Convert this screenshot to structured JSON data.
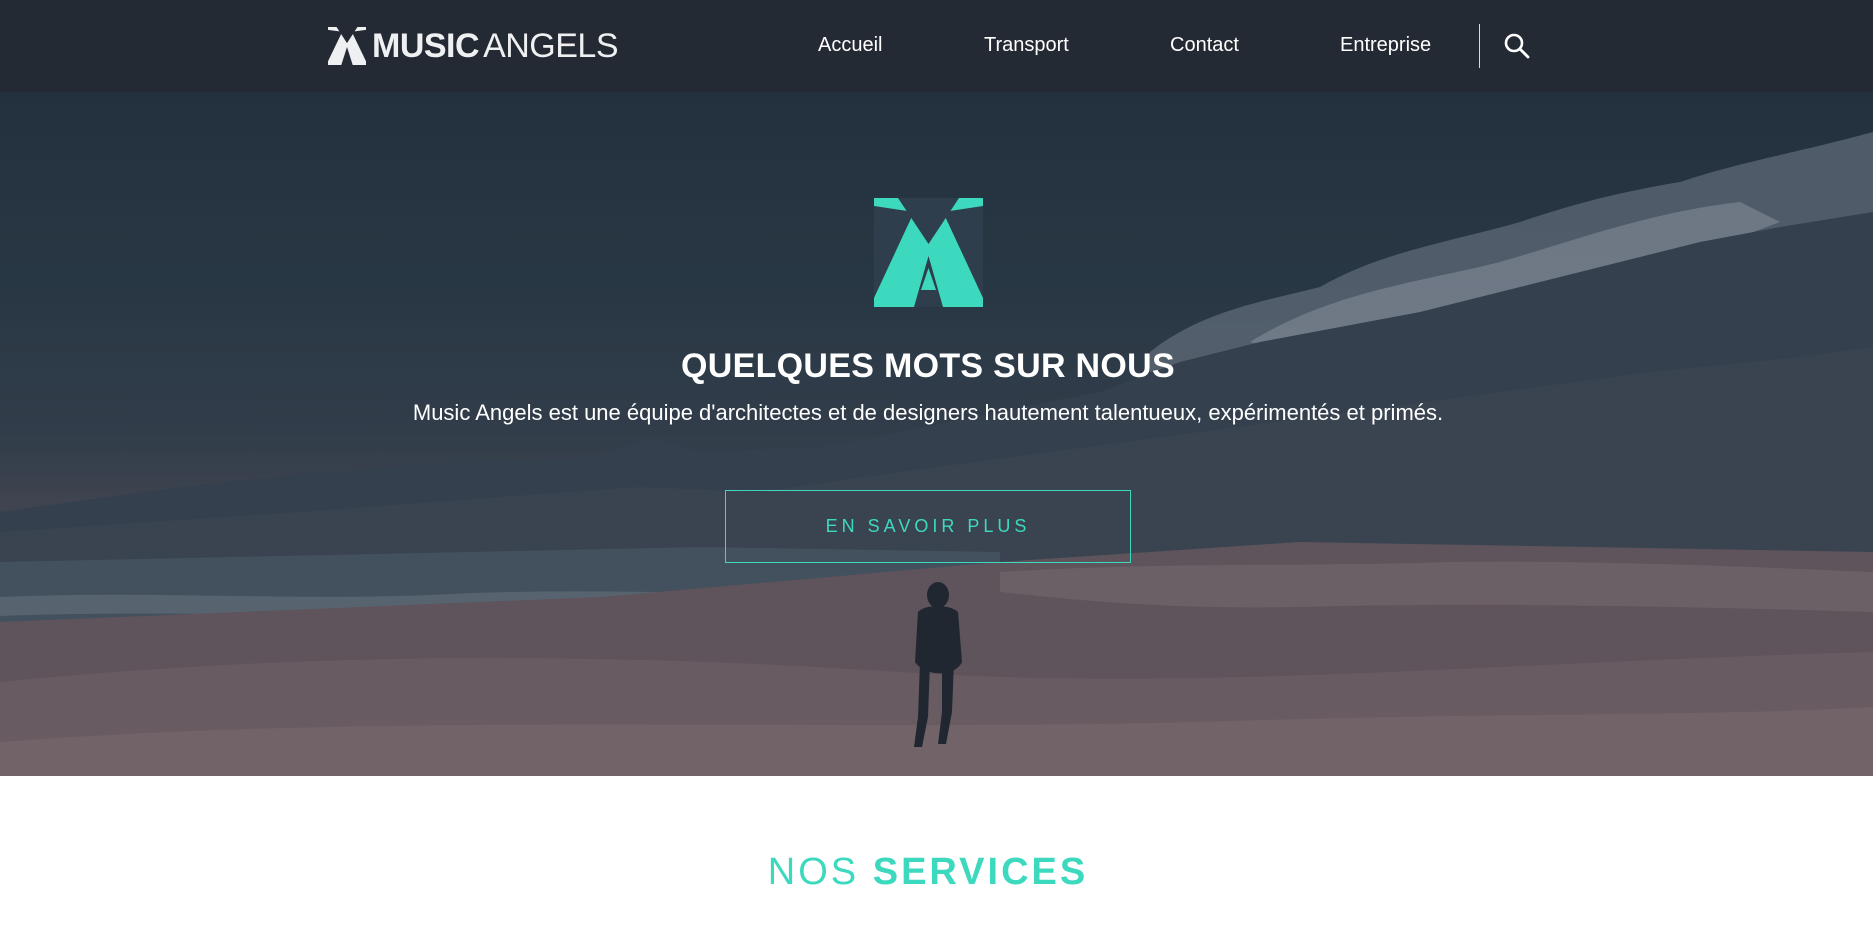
{
  "brand": {
    "name_bold": "MUSIC",
    "name_light": "ANGELS",
    "logo_icon": "music-angels-logo-icon"
  },
  "nav": {
    "items": [
      {
        "label": "Accueil"
      },
      {
        "label": "Transport"
      },
      {
        "label": "Contact"
      },
      {
        "label": "Entreprise"
      }
    ],
    "search_icon": "search-icon"
  },
  "hero": {
    "title": "QUELQUES MOTS SUR NOUS",
    "subtitle": "Music Angels est une équipe d'architectes et de designers hautement talentueux, expérimentés et primés.",
    "cta_label": "EN SAVOIR PLUS"
  },
  "services": {
    "title_light": "NOS",
    "title_bold": "SERVICES"
  },
  "colors": {
    "navbar_bg": "#242a33",
    "accent": "#3dd9bf",
    "text_light": "#ffffff"
  }
}
